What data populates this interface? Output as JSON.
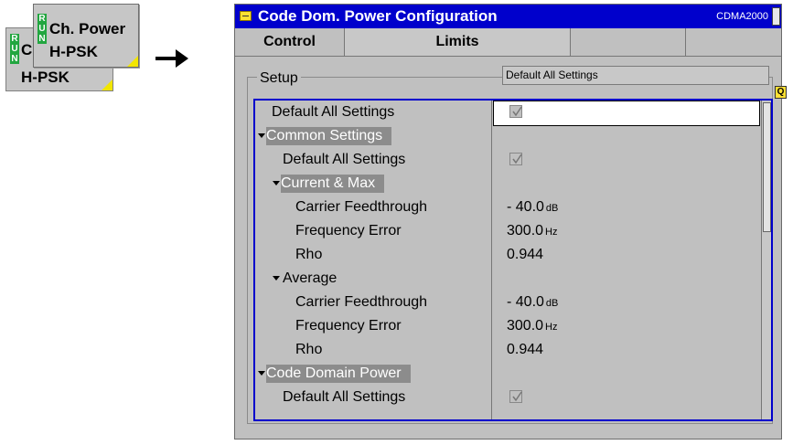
{
  "softkeys": {
    "back": {
      "run_letters": "RUN",
      "line1": "C",
      "line2": "H-PSK"
    },
    "front": {
      "run_letters": "RUN",
      "line1": "Ch. Power",
      "line2": "H-PSK"
    }
  },
  "dialog": {
    "title": "Code Dom. Power Configuration",
    "mode": "CDMA2000",
    "tabs": [
      "Control",
      "Limits",
      "",
      ""
    ],
    "active_tab": "Limits",
    "setup": {
      "label": "Setup",
      "default_field": "Default All Settings",
      "rows": [
        {
          "label": "Default All Settings",
          "value": "",
          "unit": "",
          "checkbox": true
        },
        {
          "label": "Common Settings",
          "value": "",
          "unit": "",
          "section": true
        },
        {
          "label": "Default All Settings",
          "value": "",
          "unit": "",
          "checkbox": true
        },
        {
          "label": "Current & Max",
          "value": "",
          "unit": "",
          "section": true
        },
        {
          "label": "Carrier Feedthrough",
          "value": "- 40.0",
          "unit": "dB"
        },
        {
          "label": "Frequency Error",
          "value": "300.0",
          "unit": "Hz"
        },
        {
          "label": "Rho",
          "value": "0.944",
          "unit": ""
        },
        {
          "label": "Average",
          "value": "",
          "unit": "",
          "section": true
        },
        {
          "label": "Carrier Feedthrough",
          "value": "- 40.0",
          "unit": "dB"
        },
        {
          "label": "Frequency Error",
          "value": "300.0",
          "unit": "Hz"
        },
        {
          "label": "Rho",
          "value": "0.944",
          "unit": ""
        },
        {
          "label": "Code Domain Power",
          "value": "",
          "unit": "",
          "section": true
        },
        {
          "label": "Default All Settings",
          "value": "",
          "unit": "",
          "checkbox": true
        }
      ]
    }
  },
  "colors": {
    "titlebar": "#0000cc",
    "run_badge": "#22a640",
    "softkey_corner": "#f2e600",
    "section_highlight": "#8c8c8c"
  }
}
